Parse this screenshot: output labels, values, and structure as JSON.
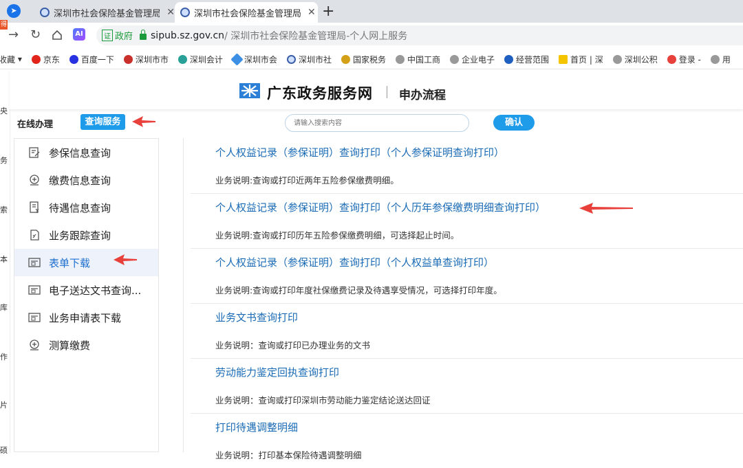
{
  "browser": {
    "tabs": [
      {
        "title": "深圳市社会保险基金管理局-"
      },
      {
        "title": "深圳市社会保险基金管理局-"
      }
    ],
    "red_badge": "得",
    "ai_label": "AI",
    "gov_label": "政府",
    "gov_box": "证",
    "url_host": "sipub.sz.gov.cn",
    "url_rest": " / 深圳市社会保险基金管理局-个人网上服务",
    "bookmarks": [
      "收藏",
      "京东",
      "百度一下",
      "深圳市市",
      "深圳会计",
      "深圳市会",
      "深圳市社",
      "国家税务",
      "中国工商",
      "企业电子",
      "经营范围",
      "首页 | 深",
      "深圳公积",
      "登录 -",
      "用"
    ]
  },
  "left_strip": [
    "央",
    "务",
    "索",
    "本",
    "库",
    "作",
    "片",
    "硕"
  ],
  "site": {
    "name": "广东政务服务网",
    "subtitle": "申办流程"
  },
  "online": {
    "label": "在线办理",
    "query_button": "查询服务",
    "search_placeholder": "请输入搜索内容",
    "confirm_button": "确认"
  },
  "menu": [
    {
      "label": "参保信息查询",
      "icon": "form-edit-icon"
    },
    {
      "label": "缴费信息查询",
      "icon": "payment-icon"
    },
    {
      "label": "待遇信息查询",
      "icon": "document-yen-icon"
    },
    {
      "label": "业务跟踪查询",
      "icon": "tracking-doc-icon"
    },
    {
      "label": "表单下载",
      "icon": "form-download-icon",
      "active": true
    },
    {
      "label": "电子送达文书查询...",
      "icon": "form-download-icon"
    },
    {
      "label": "业务申请表下载",
      "icon": "form-download-icon"
    },
    {
      "label": "测算缴费",
      "icon": "payment-icon"
    }
  ],
  "services": [
    {
      "title": "个人权益记录（参保证明）查询打印（个人参保证明查询打印）",
      "desc": "业务说明:查询或打印近两年五险参保缴费明细。"
    },
    {
      "title": "个人权益记录（参保证明）查询打印（个人历年参保缴费明细查询打印）",
      "desc": "业务说明:查询或打印历年五险参保缴费明细，可选择起止时间。"
    },
    {
      "title": "个人权益记录（参保证明）查询打印（个人权益单查询打印）",
      "desc": "业务说明:查询或打印年度社保缴费记录及待遇享受情况，可选择打印年度。"
    },
    {
      "title": "业务文书查询打印",
      "desc": "业务说明：查询或打印已办理业务的文书"
    },
    {
      "title": "劳动能力鉴定回执查询打印",
      "desc": "业务说明：查询或打印深圳市劳动能力鉴定结论送达回证"
    },
    {
      "title": "打印待遇调整明细",
      "desc": "业务说明：打印基本保险待遇调整明细"
    }
  ],
  "colors": {
    "accent": "#1e9be9",
    "link": "#1a6bb5",
    "arrow": "#e8413b",
    "active_menu_bg": "#eef2fb"
  }
}
